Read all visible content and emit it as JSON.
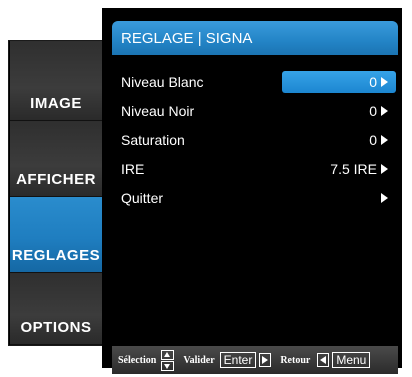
{
  "tabs": [
    {
      "label": "IMAGE",
      "active": false
    },
    {
      "label": "AFFICHER",
      "active": false
    },
    {
      "label": "REGLAGES",
      "active": true
    },
    {
      "label": "OPTIONS",
      "active": false
    }
  ],
  "menu": {
    "title": "REGLAGE | SIGNA",
    "items": [
      {
        "label": "Niveau Blanc",
        "value": "0"
      },
      {
        "label": "Niveau Noir",
        "value": "0"
      },
      {
        "label": "Saturation",
        "value": "0"
      },
      {
        "label": "IRE",
        "value": "7.5 IRE"
      },
      {
        "label": "Quitter",
        "value": ""
      }
    ],
    "selected_index": 0
  },
  "help": {
    "selection": "Sélection",
    "validate": "Valider",
    "enter_key": "Enter",
    "back": "Retour",
    "menu_key": "Menu"
  },
  "colors": {
    "accent": "#1f86cf",
    "panel_bg": "#000000",
    "tab_bg": "#353535"
  }
}
